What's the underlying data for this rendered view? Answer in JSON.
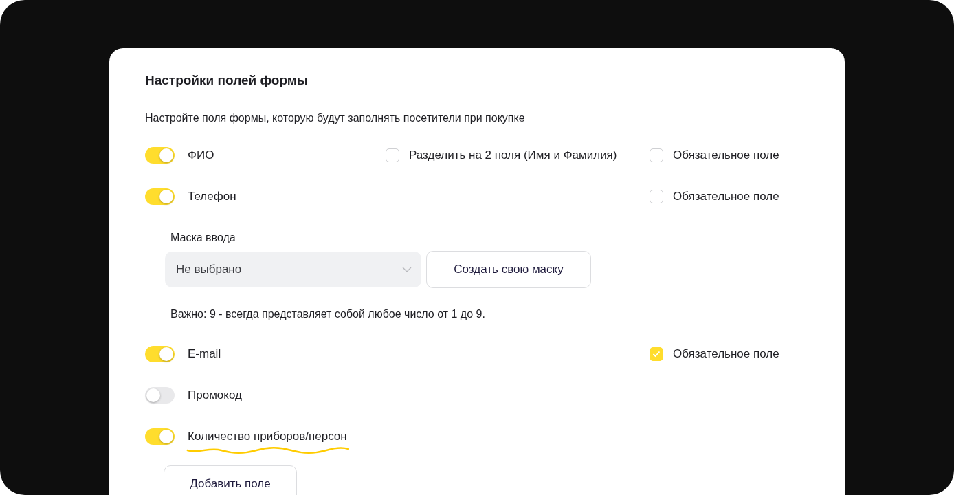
{
  "section": {
    "title": "Настройки полей формы",
    "description": "Настройте поля формы, которую будут заполнять посетители при покупке"
  },
  "fields": [
    {
      "label": "ФИО",
      "on": true,
      "split": {
        "label": "Разделить на 2 поля (Имя и Фамилия)",
        "checked": false
      },
      "required": {
        "label": "Обязательное поле",
        "checked": false
      }
    },
    {
      "label": "Телефон",
      "on": true,
      "required": {
        "label": "Обязательное поле",
        "checked": false
      },
      "mask": {
        "label": "Маска ввода",
        "value": "Не выбрано",
        "button": "Создать свою маску",
        "note": "Важно: 9 - всегда представляет собой любое число от 1 до 9."
      }
    },
    {
      "label": "E-mail",
      "on": true,
      "required": {
        "label": "Обязательное поле",
        "checked": true
      }
    },
    {
      "label": "Промокод",
      "on": false
    },
    {
      "label": "Количество приборов/персон",
      "on": true,
      "highlighted": true
    }
  ],
  "add_button": "Добавить поле"
}
